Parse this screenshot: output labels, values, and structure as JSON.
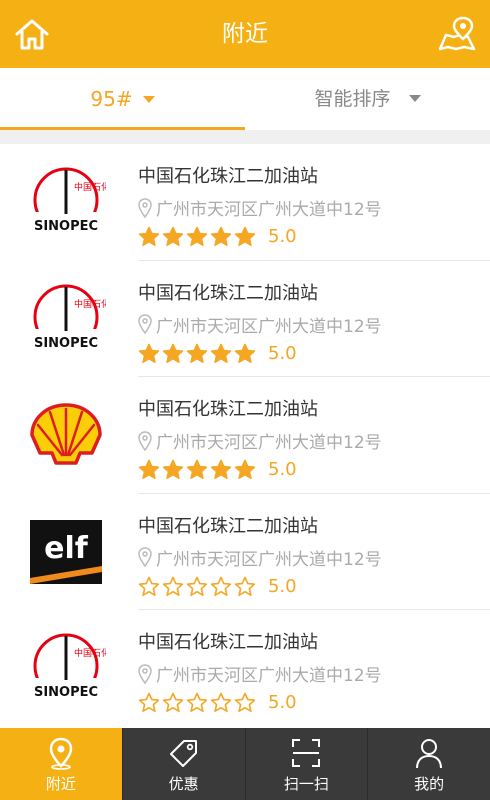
{
  "header": {
    "title": "附近"
  },
  "filters": {
    "fuel": "95#",
    "sort": "智能排序"
  },
  "stations": [
    {
      "brand": "sinopec",
      "name": "中国石化珠江二加油站",
      "address": "广州市天河区广州大道中12号",
      "rating": 5,
      "score": "5.0"
    },
    {
      "brand": "sinopec",
      "name": "中国石化珠江二加油站",
      "address": "广州市天河区广州大道中12号",
      "rating": 5,
      "score": "5.0"
    },
    {
      "brand": "shell",
      "name": "中国石化珠江二加油站",
      "address": "广州市天河区广州大道中12号",
      "rating": 5,
      "score": "5.0"
    },
    {
      "brand": "elf",
      "name": "中国石化珠江二加油站",
      "address": "广州市天河区广州大道中12号",
      "rating": 0,
      "score": "5.0"
    },
    {
      "brand": "sinopec",
      "name": "中国石化珠江二加油站",
      "address": "广州市天河区广州大道中12号",
      "rating": 0,
      "score": "5.0"
    }
  ],
  "logos": {
    "elf": "elf",
    "sinopec_text": "SINOPEC",
    "sinopec_cn": "中国石化"
  },
  "nav": {
    "tabs": [
      {
        "label": "附近",
        "icon": "location-pin-icon",
        "active": true
      },
      {
        "label": "优惠",
        "icon": "tag-icon",
        "active": false
      },
      {
        "label": "扫一扫",
        "icon": "scan-icon",
        "active": false
      },
      {
        "label": "我的",
        "icon": "user-icon",
        "active": false
      }
    ]
  },
  "colors": {
    "accent": "#f5b014",
    "nav_bg": "#3a3a3a",
    "star": "#f5a623"
  }
}
